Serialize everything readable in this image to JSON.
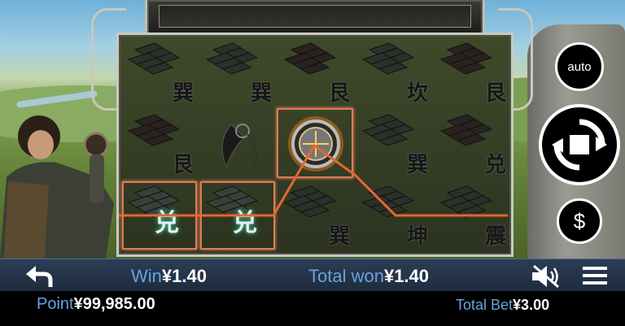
{
  "reels": {
    "grid": [
      [
        {
          "symbol": "brick",
          "char": "巽"
        },
        {
          "symbol": "brick",
          "char": "巽"
        },
        {
          "symbol": "brick",
          "char": "艮"
        },
        {
          "symbol": "brick",
          "char": "坎"
        },
        {
          "symbol": "brick",
          "char": "艮"
        }
      ],
      [
        {
          "symbol": "brick",
          "char": "艮"
        },
        {
          "symbol": "dagger",
          "char": ""
        },
        {
          "symbol": "compass-wild",
          "char": ""
        },
        {
          "symbol": "brick",
          "char": "巽"
        },
        {
          "symbol": "brick",
          "char": "兑"
        }
      ],
      [
        {
          "symbol": "brick-highlight",
          "char": "兑"
        },
        {
          "symbol": "brick-highlight",
          "char": "兑"
        },
        {
          "symbol": "brick",
          "char": "巽"
        },
        {
          "symbol": "brick",
          "char": "坤"
        },
        {
          "symbol": "brick",
          "char": "震"
        }
      ]
    ],
    "win_line_color": "#e8662f",
    "highlight_color": "#e07a56"
  },
  "buttons": {
    "auto_label": "auto",
    "spin_icon": "spin-refresh-icon",
    "currency_label": "$"
  },
  "status_bar": {
    "back_icon": "back-arrow-icon",
    "win_label": "Win",
    "win_value": "¥1.40",
    "total_won_label": "Total won",
    "total_won_value": "¥1.40",
    "sound_icon": "speaker-muted-icon",
    "menu_icon": "hamburger-menu-icon"
  },
  "info_bar": {
    "point_label": "Point",
    "point_value": "¥99,985.00",
    "total_bet_label": "Total Bet",
    "total_bet_value": "¥3.00"
  },
  "colors": {
    "label_blue": "#6aa2d8",
    "bar_bg": "#2b3d55"
  }
}
